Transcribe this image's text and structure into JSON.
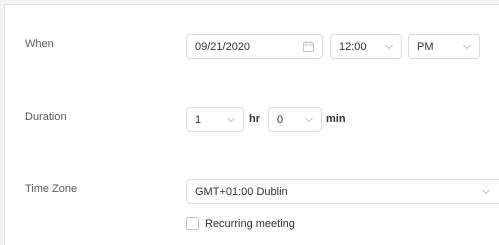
{
  "when": {
    "label": "When",
    "date": "09/21/2020",
    "time": "12:00",
    "ampm": "PM"
  },
  "duration": {
    "label": "Duration",
    "hours": "1",
    "hours_unit": "hr",
    "minutes": "0",
    "minutes_unit": "min"
  },
  "timezone": {
    "label": "Time Zone",
    "value": "GMT+01:00 Dublin"
  },
  "recurring": {
    "label": "Recurring meeting",
    "checked": false
  },
  "colors": {
    "label_text": "#5a5a5a",
    "value_text": "#333333",
    "border": "#dcdcdc",
    "chevron": "#c4c4c4"
  },
  "icons": [
    "calendar-icon",
    "chevron-down-icon"
  ]
}
